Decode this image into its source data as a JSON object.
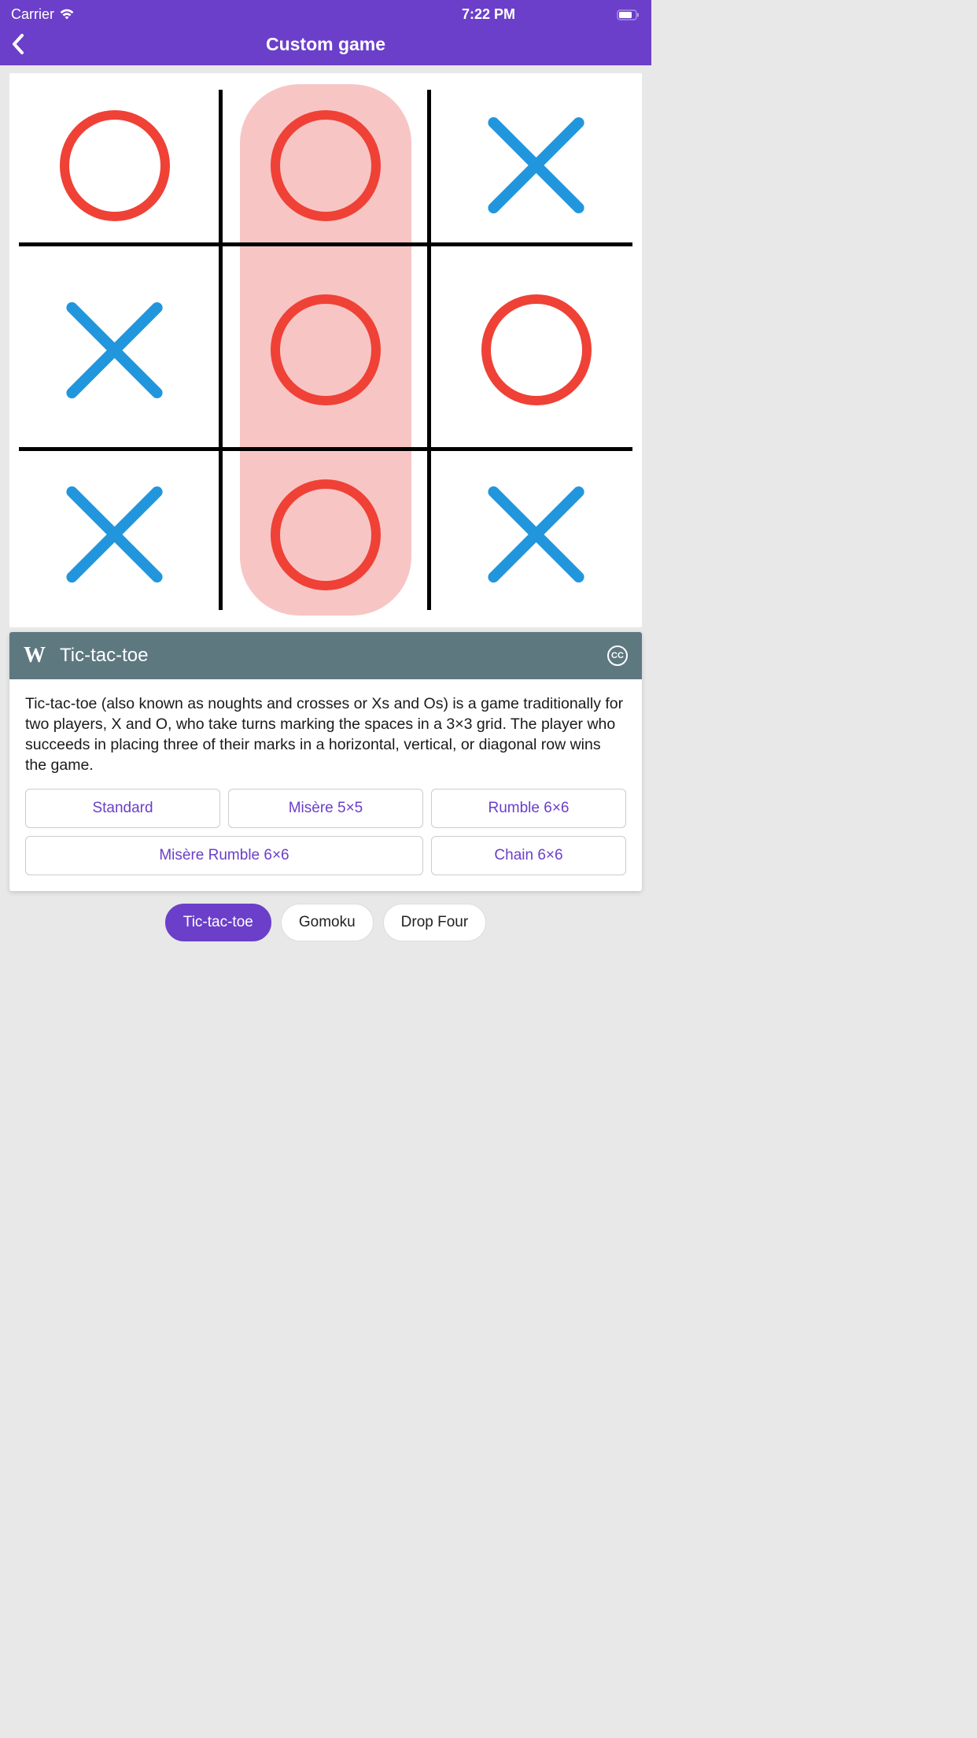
{
  "status": {
    "carrier": "Carrier",
    "time": "7:22 PM"
  },
  "nav": {
    "title": "Custom game"
  },
  "board": {
    "cells": [
      [
        "O",
        "O",
        "X"
      ],
      [
        "X",
        "O",
        "O"
      ],
      [
        "X",
        "O",
        "X"
      ]
    ],
    "win_column": 1
  },
  "info": {
    "title": "Tic-tac-toe",
    "description": "Tic-tac-toe (also known as noughts and crosses or Xs and Os) is a game traditionally for two players, X and O, who take turns marking the spaces in a 3×3 grid. The player who succeeds in placing three of their marks in a horizontal, vertical, or diagonal row wins the game."
  },
  "variants": [
    "Standard",
    "Misère 5×5",
    "Rumble 6×6",
    "Misère Rumble 6×6",
    "Chain 6×6"
  ],
  "tabs": [
    {
      "label": "Tic-tac-toe",
      "active": true
    },
    {
      "label": "Gomoku",
      "active": false
    },
    {
      "label": "Drop Four",
      "active": false
    }
  ]
}
